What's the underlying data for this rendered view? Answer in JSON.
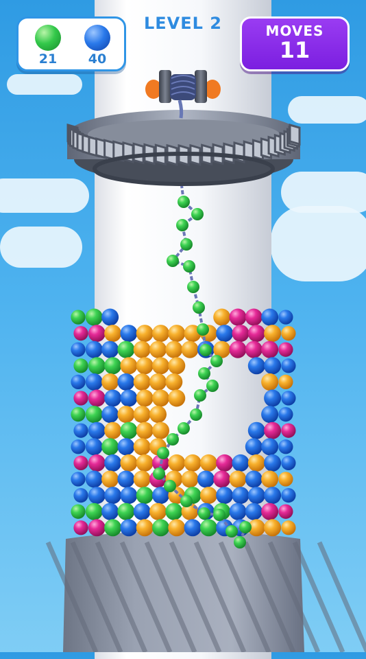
{
  "hud": {
    "level_label": "LEVEL 2",
    "moves_label": "MOVES",
    "moves_value": "11",
    "ball_counters": [
      {
        "icon": "green-ball-icon",
        "color": "#2fc44a",
        "count": "21"
      },
      {
        "icon": "blue-ball-icon",
        "color": "#1f6fe0",
        "count": "40"
      }
    ]
  },
  "colors": {
    "green": "#2fc44a",
    "blue": "#1f6fe0",
    "orange": "#f5a623",
    "magenta": "#e0208f",
    "moves_panel": "#8a2be2",
    "accent": "#2e8be0"
  }
}
